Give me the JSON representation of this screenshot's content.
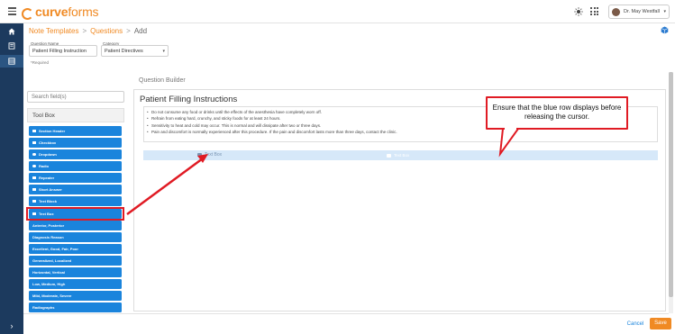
{
  "header": {
    "logo_bold": "curve",
    "logo_light": "forms",
    "user_name": "Dr. May Westfall"
  },
  "breadcrumb": {
    "items": [
      "Note Templates",
      "Questions",
      "Add"
    ],
    "separator": ">"
  },
  "form": {
    "question_name_label": "Question Name",
    "question_name_value": "Patient Filling Instruction",
    "category_label": "Category",
    "category_value": "Patient Directives",
    "required_note": "*Required"
  },
  "builder": {
    "section_label": "Question Builder",
    "title": "Patient Filling Instructions",
    "instructions": [
      "Do not consume any food or drinks until the effects of the anesthesia have completely worn off.",
      "Refrain from eating hard, crunchy, and sticky foods for at least 24 hours.",
      "Sensitivity to heat and cold may occur. This is normal and will dissipate after two or three days.",
      "Pain and discomfort is normally experienced after this procedure. If the pain and discomfort lasts more than three days, contact the clinic."
    ],
    "drop_ghost_label": "Text Box",
    "drop_ghost_label_2": "Text Box"
  },
  "toolbox": {
    "search_placeholder": "Search field(s)",
    "heading": "Tool Box",
    "items": [
      {
        "label": "Section Header",
        "icon": "section-header-icon"
      },
      {
        "label": "Checkbox",
        "icon": "checkbox-icon"
      },
      {
        "label": "Dropdown",
        "icon": "dropdown-icon"
      },
      {
        "label": "Radio",
        "icon": "radio-icon"
      },
      {
        "label": "Repeater",
        "icon": "repeater-icon"
      },
      {
        "label": "Short Answer",
        "icon": "short-answer-icon"
      },
      {
        "label": "Text Block",
        "icon": "text-block-icon"
      },
      {
        "label": "Text Box",
        "icon": "text-box-icon"
      },
      {
        "label": "Anterior, Posterior",
        "icon": ""
      },
      {
        "label": "Diagnosis Reason",
        "icon": ""
      },
      {
        "label": "Excellent, Good, Fair, Poor",
        "icon": ""
      },
      {
        "label": "Generalized, Localized",
        "icon": ""
      },
      {
        "label": "Horizontal, Vertical",
        "icon": ""
      },
      {
        "label": "Low, Medium, High",
        "icon": ""
      },
      {
        "label": "Mild, Moderate, Severe",
        "icon": ""
      },
      {
        "label": "Radiographs",
        "icon": ""
      }
    ]
  },
  "callout": {
    "text": "Ensure that the blue row displays before releasing the cursor."
  },
  "footer": {
    "cancel": "Cancel",
    "save": "Save"
  },
  "colors": {
    "brand_orange": "#f08a24",
    "sidebar_navy": "#1c3a5e",
    "tool_blue": "#1a84dc",
    "annotation_red": "#e01b24",
    "drop_row_blue": "#d6e8f9"
  }
}
